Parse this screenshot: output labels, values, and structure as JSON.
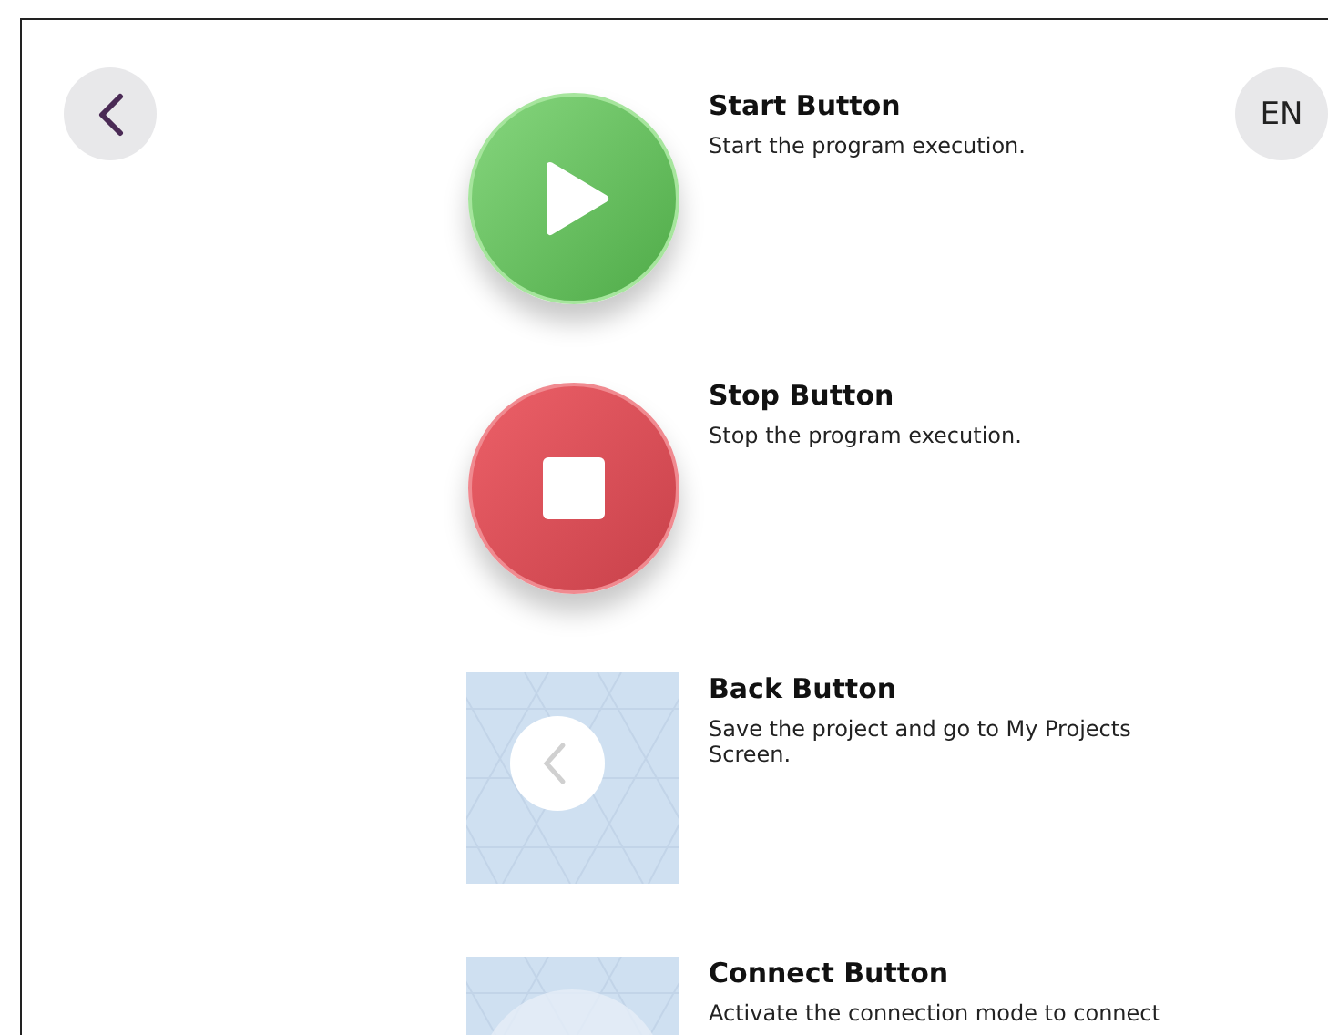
{
  "language_button": "EN",
  "items": [
    {
      "kind": "start",
      "title": "Start Button",
      "description": "Start the program execution."
    },
    {
      "kind": "stop",
      "title": "Stop Button",
      "description": "Stop the program execution."
    },
    {
      "kind": "back-preview",
      "title": "Back Button",
      "description": "Save the project and go to My Projects Screen."
    },
    {
      "kind": "connect-preview",
      "title": "Connect Button",
      "description": "Activate the connection mode to connect"
    }
  ]
}
